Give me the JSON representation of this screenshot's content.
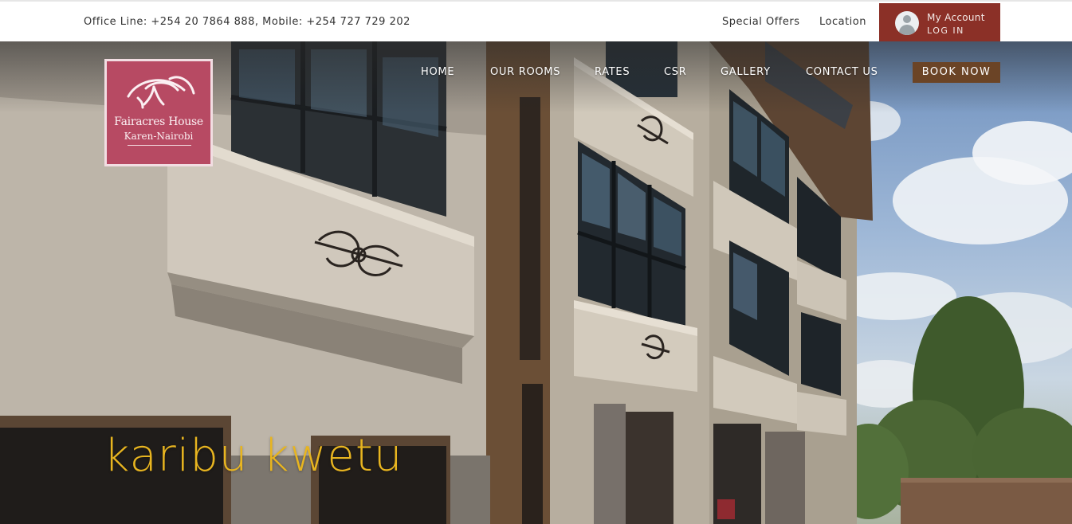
{
  "topbar": {
    "contact_line": "Office Line: +254 20 7864 888, Mobile: +254 727 729 202",
    "special_offers": "Special Offers",
    "location": "Location",
    "account": {
      "title": "My Account",
      "login": "LOG IN"
    }
  },
  "logo": {
    "name": "Fairacres House",
    "subtitle": "Karen-Nairobi"
  },
  "nav": {
    "items": [
      {
        "label": "HOME"
      },
      {
        "label": "OUR ROOMS"
      },
      {
        "label": "RATES"
      },
      {
        "label": "CSR"
      },
      {
        "label": "GALLERY"
      },
      {
        "label": "CONTACT US"
      }
    ],
    "book_now": "BOOK NOW"
  },
  "hero": {
    "tagline": "karibu kwetu"
  },
  "colors": {
    "account_bg": "#8b3027",
    "logo_bg": "#b74a63",
    "book_now_bg": "#6b4426",
    "tagline": "#e8b520"
  }
}
